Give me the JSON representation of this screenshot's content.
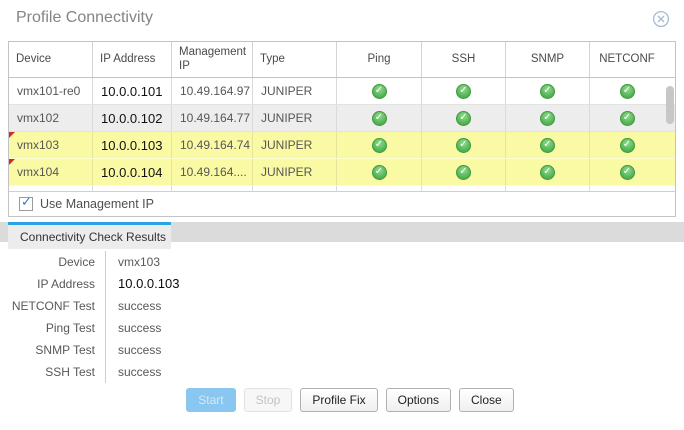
{
  "dialog": {
    "title": "Profile Connectivity"
  },
  "grid": {
    "columns": [
      "Device",
      "IP Address",
      "Management IP",
      "Type",
      "Ping",
      "SSH",
      "SNMP",
      "NETCONF"
    ],
    "rows": [
      {
        "device": "vmx101-re0",
        "ip": "10.0.0.101",
        "management_ip": "10.49.164.97",
        "type": "JUNIPER",
        "ping": "success",
        "ssh": "success",
        "snmp": "success",
        "netconf": "success",
        "highlighted": false,
        "modified": false
      },
      {
        "device": "vmx102",
        "ip": "10.0.0.102",
        "management_ip": "10.49.164.77",
        "type": "JUNIPER",
        "ping": "success",
        "ssh": "success",
        "snmp": "success",
        "netconf": "success",
        "highlighted": false,
        "modified": false
      },
      {
        "device": "vmx103",
        "ip": "10.0.0.103",
        "management_ip": "10.49.164.74",
        "type": "JUNIPER",
        "ping": "success",
        "ssh": "success",
        "snmp": "success",
        "netconf": "success",
        "highlighted": true,
        "modified": true
      },
      {
        "device": "vmx104",
        "ip": "10.0.0.104",
        "management_ip": "10.49.164....",
        "type": "JUNIPER",
        "ping": "success",
        "ssh": "success",
        "snmp": "success",
        "netconf": "success",
        "highlighted": true,
        "modified": true
      }
    ],
    "footer": {
      "checkbox_label": "Use Management IP",
      "checked": true
    }
  },
  "tabs": [
    {
      "label": "Connectivity Check Results",
      "active": true
    }
  ],
  "details": {
    "rows": [
      {
        "label": "Device",
        "value": "vmx103"
      },
      {
        "label": "IP Address",
        "value": "10.0.0.103"
      },
      {
        "label": "NETCONF Test",
        "value": "success"
      },
      {
        "label": "Ping Test",
        "value": "success"
      },
      {
        "label": "SNMP Test",
        "value": "success"
      },
      {
        "label": "SSH Test",
        "value": "success"
      }
    ]
  },
  "buttons": {
    "start": "Start",
    "stop": "Stop",
    "profile_fix": "Profile Fix",
    "options": "Options",
    "close": "Close"
  },
  "icons": {
    "close": "circled-x-icon",
    "status": "green-check-icon"
  },
  "colors": {
    "highlight_row": "#fafaa4",
    "accent_blue": "#2aa2e8",
    "success_green": "#57b557",
    "primary_button_blue": "#89c6f0",
    "modified_marker_red": "#cf2a27"
  }
}
